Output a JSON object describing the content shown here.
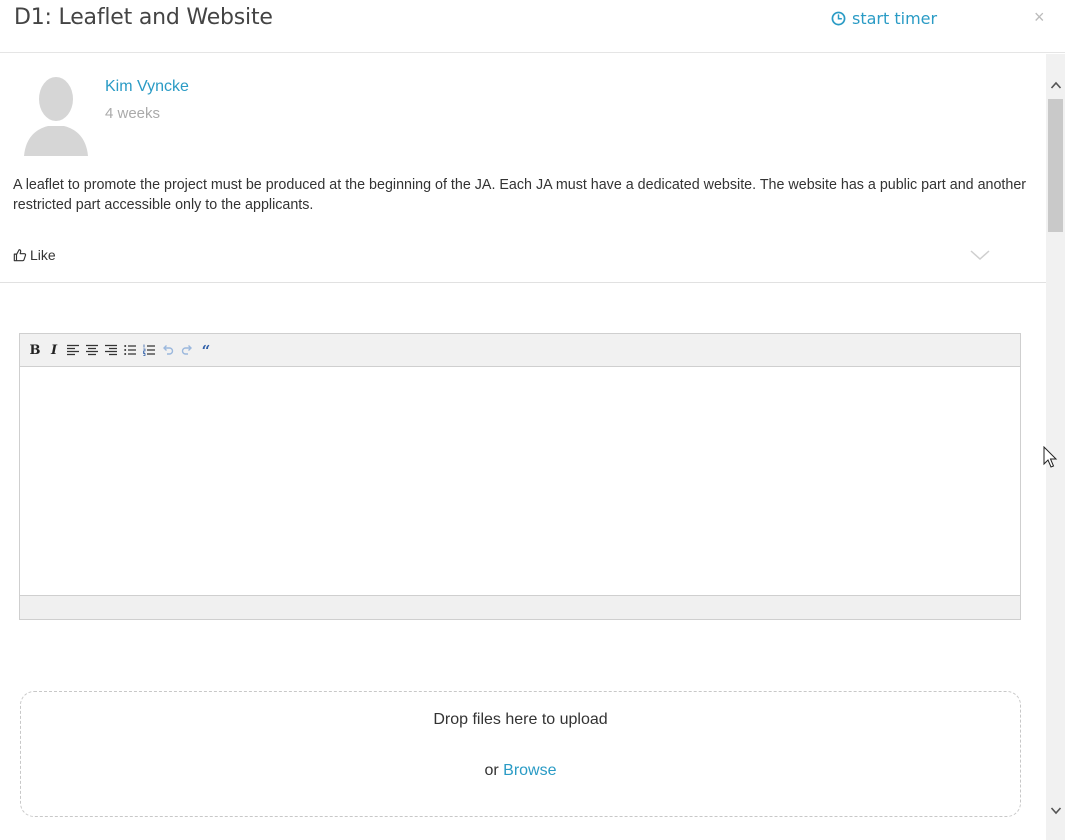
{
  "header": {
    "title": "D1: Leaflet and Website",
    "timer_label": "start timer",
    "close_label": "×"
  },
  "post": {
    "author": "Kim Vyncke",
    "time_ago": "4 weeks",
    "body": "A leaflet to promote the project must be produced at the beginning of the JA. Each JA must have a dedicated website. The website has a public part and another restricted part accessible only to the applicants.",
    "like_label": "Like"
  },
  "editor": {
    "toolbar": {
      "bold": "B",
      "italic": "I",
      "blockquote": "“"
    },
    "value": ""
  },
  "upload": {
    "drop_label": "Drop files here to upload",
    "or_label": "or",
    "browse_label": "Browse"
  },
  "colors": {
    "link": "#2a9bc5",
    "text": "#333333",
    "muted": "#aaaaaa"
  },
  "icons": {
    "timer": "clock-icon",
    "like": "thumbs-up-icon",
    "expand": "chevron-down-icon"
  }
}
